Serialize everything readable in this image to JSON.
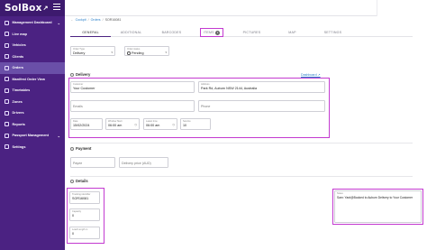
{
  "app": {
    "logo": "SolBox",
    "logo_mark": "↗"
  },
  "sidebar": {
    "items": [
      {
        "label": "Management Dashboard",
        "chevron": "⌄"
      },
      {
        "label": "Live map"
      },
      {
        "label": "Vehicles"
      },
      {
        "label": "Clients"
      },
      {
        "label": "Orders"
      },
      {
        "label": "Manifest Order View"
      },
      {
        "label": "Timetables"
      },
      {
        "label": "Zones"
      },
      {
        "label": "Drivers"
      },
      {
        "label": "Reports"
      },
      {
        "label": "Passport Management",
        "chevron": "⌄"
      },
      {
        "label": "Settings"
      }
    ],
    "active_index": 4
  },
  "breadcrumb": {
    "home": "Cockpit",
    "section": "Orders",
    "current": "SOR16081"
  },
  "tabs": [
    {
      "label": "GENERAL"
    },
    {
      "label": "ADDITIONAL"
    },
    {
      "label": "BARCODES"
    },
    {
      "label": "ITEMS",
      "badge": "1"
    },
    {
      "label": "PICTURES"
    },
    {
      "label": "MAP"
    },
    {
      "label": "SETTINGS"
    }
  ],
  "order": {
    "type_label": "Order Type",
    "type_value": "Delivery",
    "status_label": "Order status",
    "status_value": "Pending"
  },
  "delivery": {
    "title": "Delivery",
    "dashboard_link": "Dashboard ↗",
    "customer_label": "Customer",
    "customer_value": "Your Customer",
    "address_label": "Address",
    "address_value": "Park Rd, Auburn NSW 2144, Australia",
    "emails_placeholder": "Emails",
    "phone_placeholder": "Phone",
    "date_label": "Date",
    "date_value": "15/02/2024",
    "window_start_label": "Window Start",
    "window_start_value": "06:00 am",
    "window_end_label": "Latest time",
    "window_end_value": "06:00 am",
    "service_label": "Service",
    "service_value": "10"
  },
  "payment": {
    "title": "Payment",
    "payee_placeholder": "Payee",
    "delivery_price_placeholder": "Delivery price (AUD)"
  },
  "details": {
    "title": "Details",
    "tracking_label": "Tracking identifier",
    "tracking_value": "SOR16081",
    "capacity_label": "Capacity",
    "capacity_value": "0",
    "load_label": "Load Length m",
    "load_value": "0",
    "notes_label": "Notes",
    "notes_value": "Sam: Yard@Booked to Auburn Delivery to Your Customer"
  },
  "colors": {
    "sidebar": "#4b2282",
    "highlight": "#c33ad0",
    "link": "#2a7fc9"
  }
}
